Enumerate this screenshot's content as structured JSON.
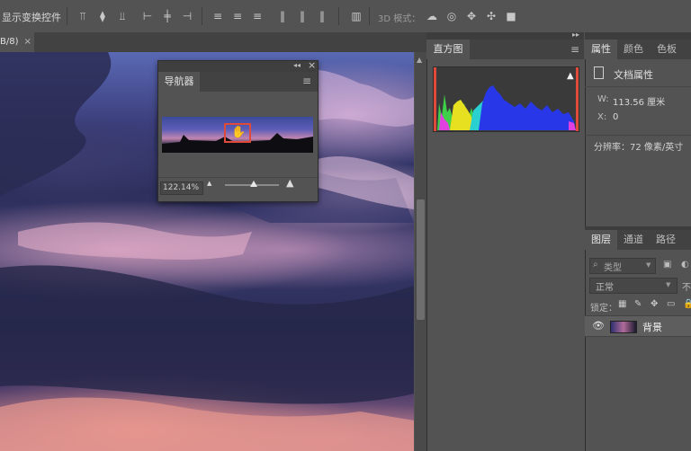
{
  "options_bar": {
    "show_transform_label": "显示变换控件",
    "mode_3d_label": "3D 模式：",
    "align_icons": [
      "align-top-icon",
      "align-vcenter-icon",
      "align-bottom-icon",
      "align-left-icon",
      "align-hcenter-icon",
      "align-right-icon"
    ],
    "distribute_icons": [
      "distribute-top-icon",
      "distribute-vcenter-icon",
      "distribute-bottom-icon",
      "distribute-left-icon",
      "distribute-hcenter-icon",
      "distribute-right-icon"
    ],
    "mode3d_icons": [
      "rotate-3d-icon",
      "roll-3d-icon",
      "drag-3d-icon",
      "slide-3d-icon",
      "scale-3d-icon"
    ]
  },
  "document_tab": {
    "label": "B/8)",
    "close": "×"
  },
  "navigator": {
    "tab_label": "导航器",
    "collapse_glyph": "◂◂",
    "close_glyph": "×",
    "menu_glyph": "≡",
    "zoom_value": "122.14%",
    "zoom_level_fraction": 0.55
  },
  "histogram_panel": {
    "tab_label": "直方图",
    "menu_glyph": "≡",
    "warning_glyph": "▲"
  },
  "properties_panel": {
    "tabs": [
      "属性",
      "颜色",
      "色板"
    ],
    "doc_props_label": "文档属性",
    "w_label": "W:",
    "w_value": "113.56 厘米",
    "x_label": "X:",
    "x_value": "0",
    "resolution": "分辨率：72 像素/英寸"
  },
  "layers_panel": {
    "tabs": [
      "图层",
      "通道",
      "路径"
    ],
    "filter_label": "类型",
    "blend_mode": "正常",
    "blend_mode_trunc": "不",
    "lock_label": "锁定：",
    "layer_name": "背景"
  },
  "colors": {
    "accent_red": "#e04a3a",
    "ui_bg": "#535353",
    "ui_dark": "#424242"
  }
}
